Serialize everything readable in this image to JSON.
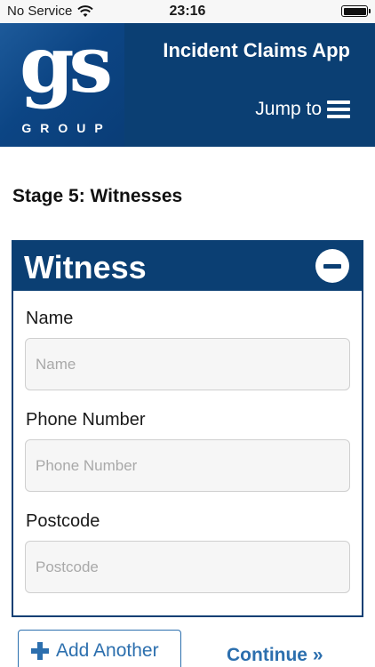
{
  "status_bar": {
    "carrier": "No Service",
    "time": "23:16",
    "wifi_icon": "wifi-icon",
    "battery_icon": "battery-icon"
  },
  "header": {
    "logo_mark": "gs",
    "logo_wordmark": "GROUP",
    "app_title": "Incident Claims App",
    "jump_to_label": "Jump to",
    "menu_icon": "hamburger-menu-icon"
  },
  "stage": {
    "title": "Stage 5: Witnesses"
  },
  "witness_panel": {
    "title": "Witness",
    "collapse_icon": "minus-circle-icon",
    "fields": {
      "name": {
        "label": "Name",
        "placeholder": "Name",
        "value": ""
      },
      "phone": {
        "label": "Phone Number",
        "placeholder": "Phone Number",
        "value": ""
      },
      "postcode": {
        "label": "Postcode",
        "placeholder": "Postcode",
        "value": ""
      }
    }
  },
  "actions": {
    "add_another_label": "Add Another",
    "add_icon": "plus-icon",
    "continue_label": "Continue »"
  },
  "colors": {
    "brand_navy": "#0b3f73",
    "link_blue": "#2c6fae",
    "input_bg": "#f6f6f6"
  }
}
